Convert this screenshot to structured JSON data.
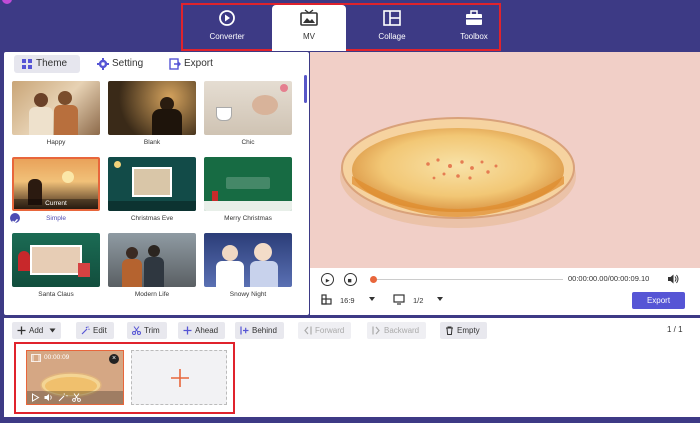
{
  "nav": {
    "tabs": [
      {
        "label": "Converter",
        "icon": "converter-icon"
      },
      {
        "label": "MV",
        "icon": "mv-icon",
        "active": true
      },
      {
        "label": "Collage",
        "icon": "collage-icon"
      },
      {
        "label": "Toolbox",
        "icon": "toolbox-icon"
      }
    ]
  },
  "panel": {
    "tabs": [
      {
        "label": "Theme",
        "icon": "grid-icon",
        "active": true
      },
      {
        "label": "Setting",
        "icon": "gear-icon"
      },
      {
        "label": "Export",
        "icon": "export-icon"
      }
    ],
    "themes": [
      {
        "name": "Happy"
      },
      {
        "name": "Blank"
      },
      {
        "name": "Chic"
      },
      {
        "name": "Simple",
        "selected": true,
        "badge": "Current"
      },
      {
        "name": "Christmas Eve"
      },
      {
        "name": "Merry Christmas"
      },
      {
        "name": "Santa Claus"
      },
      {
        "name": "Modern Life"
      },
      {
        "name": "Snowy Night"
      }
    ]
  },
  "player": {
    "timecode": "00:00:00.00/00:00:09.10",
    "aspect_ratio": "16:9",
    "page": "1/2",
    "export_label": "Export"
  },
  "toolbar": {
    "buttons": [
      {
        "label": "Add",
        "icon": "plus-icon",
        "dropdown": true
      },
      {
        "label": "Edit",
        "icon": "wand-icon"
      },
      {
        "label": "Trim",
        "icon": "scissors-icon"
      },
      {
        "label": "Ahead",
        "icon": "plus-icon"
      },
      {
        "label": "Behind",
        "icon": "insert-icon"
      },
      {
        "label": "Forward",
        "icon": "forward-icon",
        "disabled": true
      },
      {
        "label": "Backward",
        "icon": "backward-icon",
        "disabled": true
      },
      {
        "label": "Empty",
        "icon": "trash-icon"
      }
    ],
    "page_count": "1 / 1"
  },
  "timeline": {
    "clip_duration": "00:00:09",
    "add_icon": "plus-icon"
  },
  "colors": {
    "brand": "#3d3a85",
    "accent": "#5655d5",
    "highlight": "#e8663b",
    "outline": "#e0232c"
  }
}
